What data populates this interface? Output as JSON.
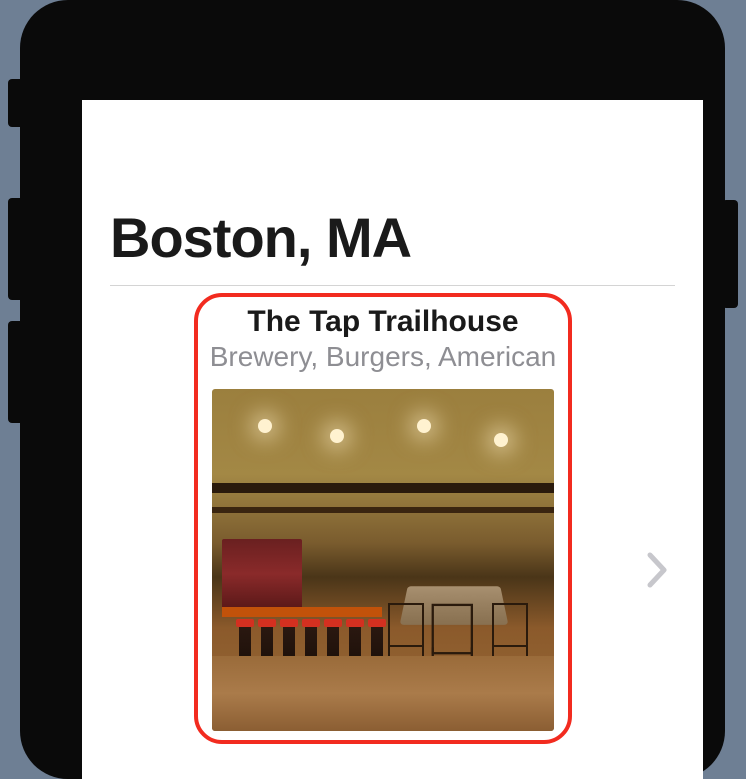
{
  "location": {
    "title": "Boston, MA"
  },
  "restaurant": {
    "name": "The Tap Trailhouse",
    "categories": "Brewery, Burgers, American"
  }
}
